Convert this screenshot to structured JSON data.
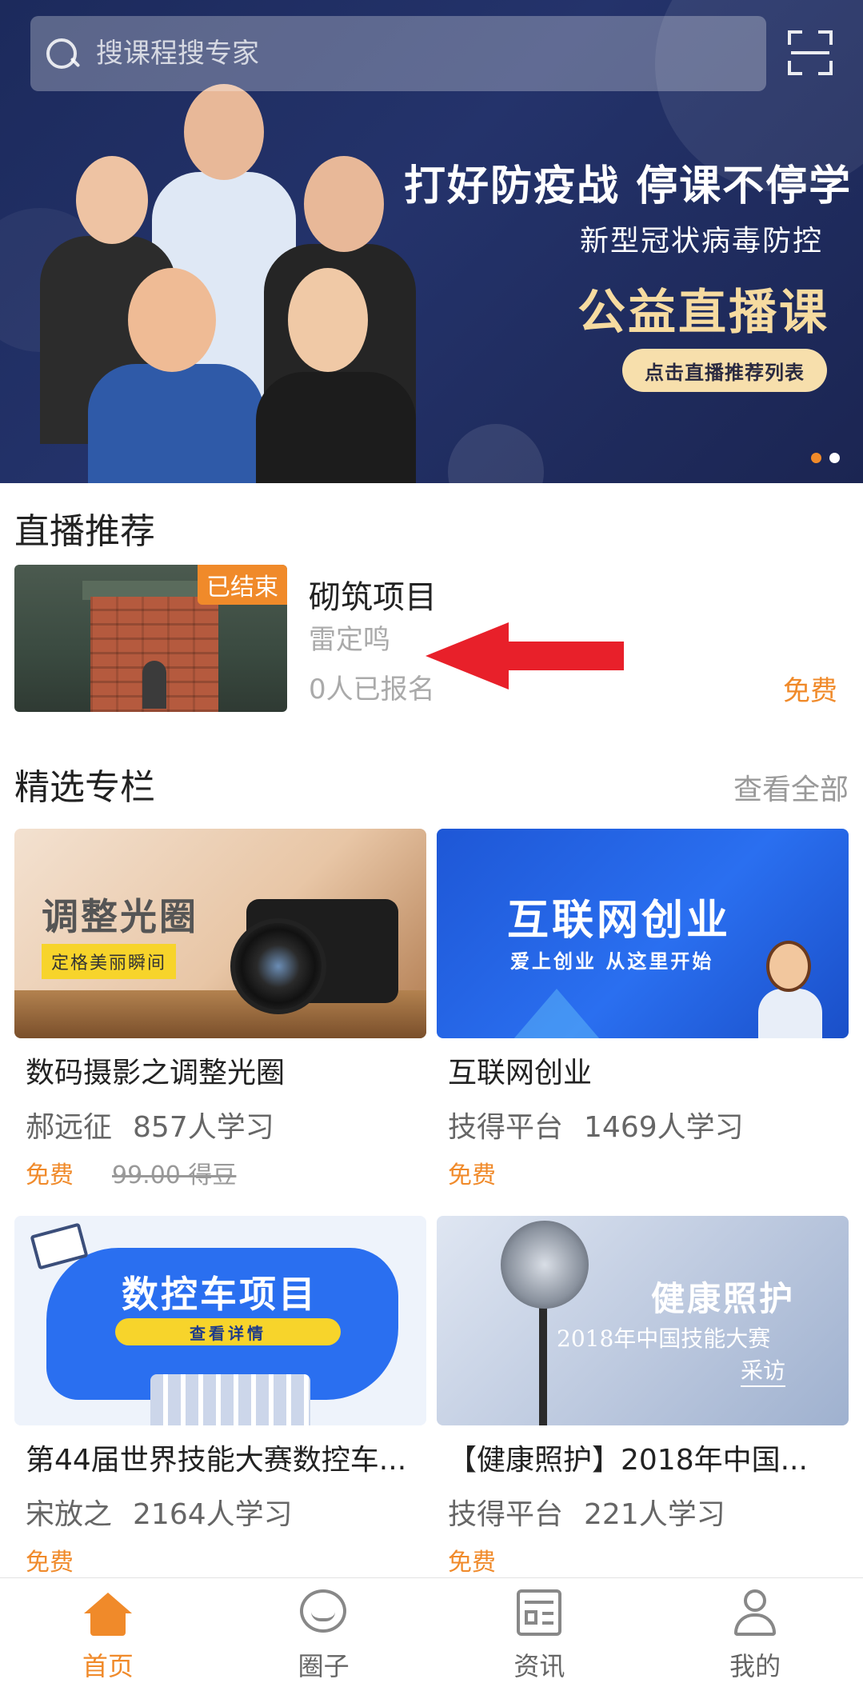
{
  "search": {
    "placeholder": "搜课程搜专家"
  },
  "banner": {
    "title": "打好防疫战 停课不停学",
    "subtitle": "新型冠状病毒防控",
    "main": "公益直播课",
    "button": "点击直播推荐列表"
  },
  "live_section": {
    "title": "直播推荐",
    "item": {
      "status": "已结束",
      "title": "砌筑项目",
      "teacher": "雷定鸣",
      "enrolled": "0人已报名",
      "price": "免费"
    }
  },
  "featured_section": {
    "title": "精选专栏",
    "see_all": "查看全部",
    "courses": [
      {
        "thumb_title": "调整光圈",
        "thumb_tag": "定格美丽瞬间",
        "title": "数码摄影之调整光圈",
        "author": "郝远征",
        "learners": "857人学习",
        "price": "免费",
        "original_price": "99.00 得豆"
      },
      {
        "thumb_title": "互联网创业",
        "thumb_sub": "爱上创业  从这里开始",
        "title": "互联网创业",
        "author": "技得平台",
        "learners": "1469人学习",
        "price": "免费"
      },
      {
        "thumb_title": "数控车项目",
        "thumb_pill": "查看详情",
        "title": "第44届世界技能大赛数控车...",
        "author": "宋放之",
        "learners": "2164人学习",
        "price": "免费"
      },
      {
        "thumb_title": "健康照护",
        "thumb_sub": "2018年中国技能大赛",
        "thumb_sub2": "采访",
        "title": "【健康照护】2018年中国...",
        "author": "技得平台",
        "learners": "221人学习",
        "price": "免费"
      }
    ]
  },
  "bottom_nav": {
    "items": [
      {
        "label": "首页",
        "icon": "home-icon",
        "active": true
      },
      {
        "label": "圈子",
        "icon": "circle-icon",
        "active": false
      },
      {
        "label": "资讯",
        "icon": "news-icon",
        "active": false
      },
      {
        "label": "我的",
        "icon": "user-icon",
        "active": false
      }
    ]
  },
  "colors": {
    "accent": "#f08a2a",
    "banner_bg": "#1c2a5c",
    "banner_gold": "#f6dba0",
    "arrow_red": "#e8202a"
  }
}
